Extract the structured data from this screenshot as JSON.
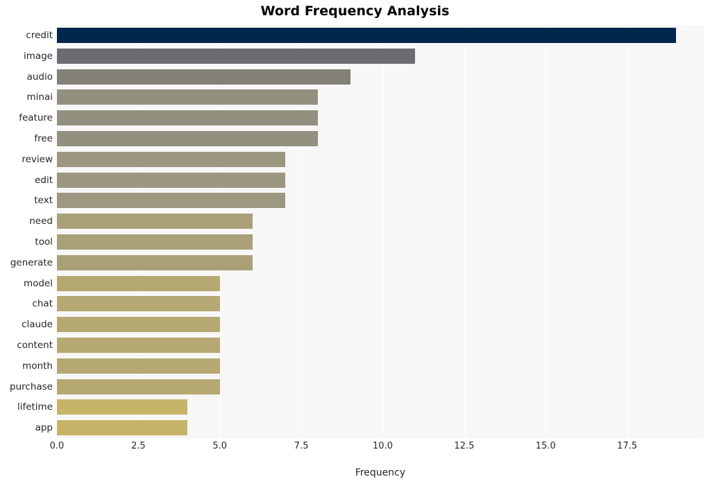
{
  "chart_data": {
    "type": "bar",
    "orientation": "horizontal",
    "title": "Word Frequency Analysis",
    "xlabel": "Frequency",
    "ylabel": "",
    "xlim": [
      0,
      19.85
    ],
    "xticks": [
      "0.0",
      "2.5",
      "5.0",
      "7.5",
      "10.0",
      "12.5",
      "15.0",
      "17.5"
    ],
    "xtick_values": [
      0,
      2.5,
      5,
      7.5,
      10,
      12.5,
      15,
      17.5
    ],
    "grid": "vertical-only",
    "legend": "none",
    "background": "#f7f7f7",
    "gridline_color": "#ffffff",
    "categories": [
      "credit",
      "image",
      "audio",
      "minai",
      "feature",
      "free",
      "review",
      "edit",
      "text",
      "need",
      "tool",
      "generate",
      "model",
      "chat",
      "claude",
      "content",
      "month",
      "purchase",
      "lifetime",
      "app"
    ],
    "values": [
      19,
      11,
      9,
      8,
      8,
      8,
      7,
      7,
      7,
      6,
      6,
      6,
      5,
      5,
      5,
      5,
      5,
      5,
      4,
      4
    ],
    "bar_colors": [
      "#00264d",
      "#6b6b72",
      "#838079",
      "#94907f",
      "#94907f",
      "#94907f",
      "#9c9780",
      "#9c9780",
      "#9c9780",
      "#a9a078",
      "#a9a078",
      "#a9a078",
      "#b5a873",
      "#b5a873",
      "#b5a873",
      "#b5a873",
      "#b5a873",
      "#b5a873",
      "#c5b468",
      "#c5b468"
    ]
  }
}
